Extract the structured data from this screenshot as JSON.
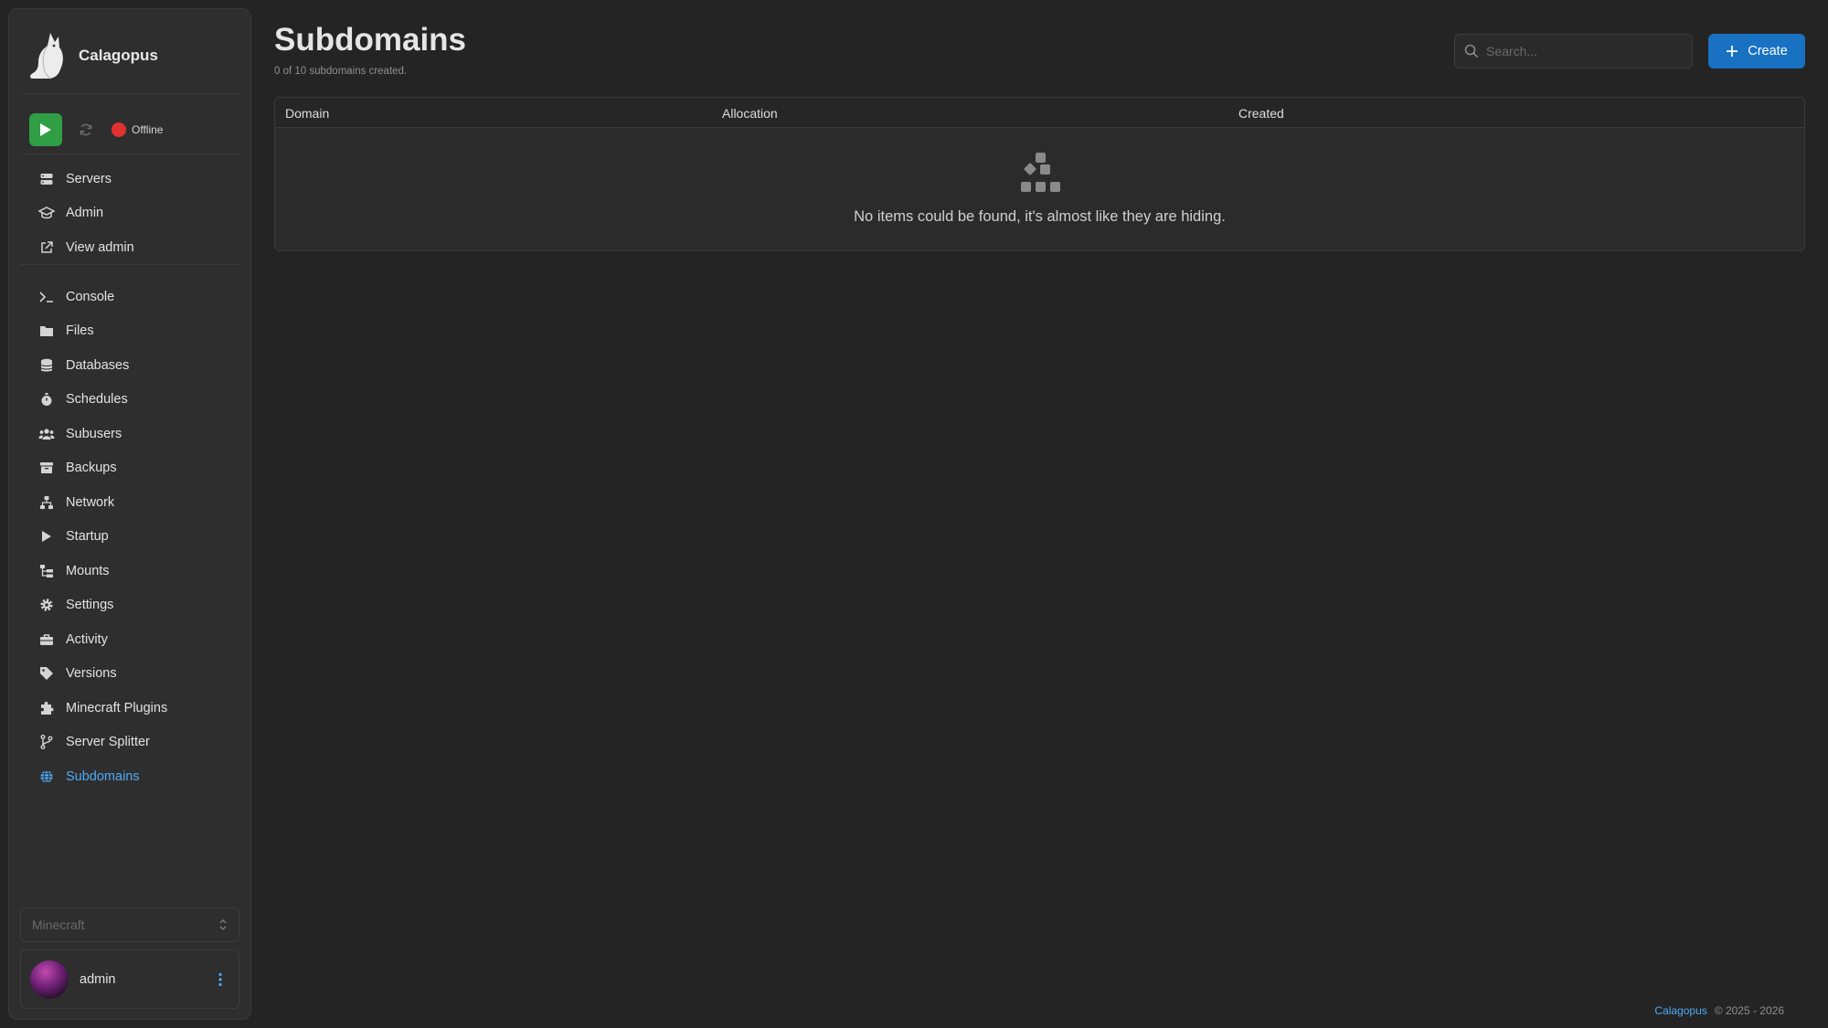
{
  "app": {
    "name": "Calagopus"
  },
  "server_controls": {
    "status_text": "Offline",
    "status_color": "#e03131",
    "start_color": "#2f9e44"
  },
  "nav_top": [
    {
      "label": "Servers",
      "icon": "servers-icon"
    },
    {
      "label": "Admin",
      "icon": "admin-icon"
    },
    {
      "label": "View admin",
      "icon": "external-link-icon"
    }
  ],
  "nav_server": [
    {
      "label": "Console",
      "icon": "terminal-icon"
    },
    {
      "label": "Files",
      "icon": "folder-icon"
    },
    {
      "label": "Databases",
      "icon": "database-icon"
    },
    {
      "label": "Schedules",
      "icon": "stopwatch-icon"
    },
    {
      "label": "Subusers",
      "icon": "users-icon"
    },
    {
      "label": "Backups",
      "icon": "archive-icon"
    },
    {
      "label": "Network",
      "icon": "network-icon"
    },
    {
      "label": "Startup",
      "icon": "play-icon"
    },
    {
      "label": "Mounts",
      "icon": "mounts-icon"
    },
    {
      "label": "Settings",
      "icon": "gear-icon"
    },
    {
      "label": "Activity",
      "icon": "briefcase-icon"
    },
    {
      "label": "Versions",
      "icon": "tag-icon"
    },
    {
      "label": "Minecraft Plugins",
      "icon": "puzzle-icon"
    },
    {
      "label": "Server Splitter",
      "icon": "branch-icon"
    },
    {
      "label": "Subdomains",
      "icon": "globe-icon",
      "active": true
    }
  ],
  "egg_select": {
    "value": "Minecraft"
  },
  "user": {
    "name": "admin"
  },
  "page": {
    "title": "Subdomains",
    "subtitle": "0 of 10 subdomains created."
  },
  "search": {
    "placeholder": "Search..."
  },
  "create_button": {
    "label": "Create"
  },
  "table": {
    "columns": [
      "Domain",
      "Allocation",
      "Created"
    ],
    "empty_text": "No items could be found, it's almost like they are hiding."
  },
  "footer": {
    "brand": "Calagopus",
    "copyright": "© 2025 - 2026"
  },
  "colors": {
    "accent": "#1971c2",
    "active_link": "#4dabf7",
    "background": "#242424",
    "sidebar": "#2e2e2e"
  }
}
